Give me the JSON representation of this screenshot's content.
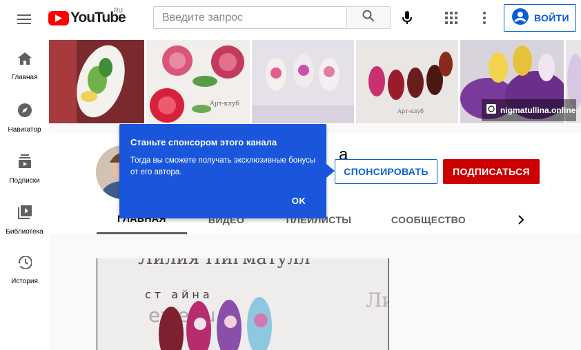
{
  "topbar": {
    "logo_text": "YouTube",
    "country_code": "RU",
    "search_placeholder": "Введите запрос",
    "login_label": "ВОЙТИ"
  },
  "sidebar": {
    "items": [
      {
        "label": "Главная",
        "icon": "home-icon"
      },
      {
        "label": "Навигатор",
        "icon": "compass-icon"
      },
      {
        "label": "Подписки",
        "icon": "subscriptions-icon"
      },
      {
        "label": "Библиотека",
        "icon": "library-icon"
      },
      {
        "label": "История",
        "icon": "history-icon"
      }
    ]
  },
  "banner": {
    "link_text": "nigmatullina.online"
  },
  "channel": {
    "name_visible": "а",
    "sponsor_label": "СПОНСИРОВАТЬ",
    "subscribe_label": "ПОДПИСАТЬСЯ"
  },
  "tabs": [
    {
      "label": "ГЛАВНАЯ"
    },
    {
      "label": "ВИДЕО"
    },
    {
      "label": "ПЛЕЙЛИСТЫ"
    },
    {
      "label": "СООБЩЕСТВО"
    }
  ],
  "popup": {
    "title": "Станьте спонсором этого канала",
    "text": "Тогда вы сможете получать эксклюзивные бонусы от его автора.",
    "ok_label": "OK"
  },
  "video": {
    "overlay_top": "Лилия Нигматулл",
    "overlay_mid": "ст           айна",
    "overlay_bottom": "ex       e.ru",
    "overlay_right": "Ли"
  },
  "colors": {
    "brand_red": "#ff0000",
    "subscribe_red": "#cc0000",
    "link_blue": "#065fd4",
    "popup_blue": "#1a56db"
  }
}
